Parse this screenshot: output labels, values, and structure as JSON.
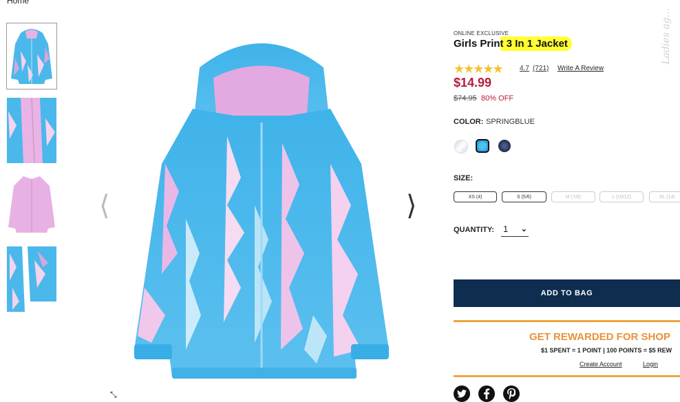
{
  "breadcrumb": {
    "home": "Home"
  },
  "product": {
    "badge": "ONLINE EXCLUSIVE",
    "title_prefix": "Girls Prin",
    "title_highlight": "t 3 In 1 Jacket",
    "rating_stars": "★★★★★",
    "rating": "4.7",
    "reviews": "(721)",
    "write_review": "Write A Review",
    "price": "$14.99",
    "original_price": "$74.95",
    "discount": "80% OFF",
    "color_label": "COLOR:",
    "color_value": "SPRINGBLUE",
    "size_label": "SIZE:",
    "sizes": [
      "XS (4)",
      "S (5/6)",
      "M (7/8)",
      "L (10/12)",
      "XL (14)"
    ],
    "quantity_label": "QUANTITY:",
    "quantity_value": "1",
    "add_to_bag": "ADD TO BAG"
  },
  "rewards": {
    "title": "GET REWARDED FOR SHOP",
    "subtitle": "$1 SPENT = 1 POINT | 100 POINTS = $5 REW",
    "create_account": "Create Account",
    "login": "Login"
  },
  "gallery": {
    "prev_arrow": "⟨",
    "next_arrow": "⟩",
    "zoom_icon": "⤡"
  },
  "watermark": "Ladies ag..."
}
